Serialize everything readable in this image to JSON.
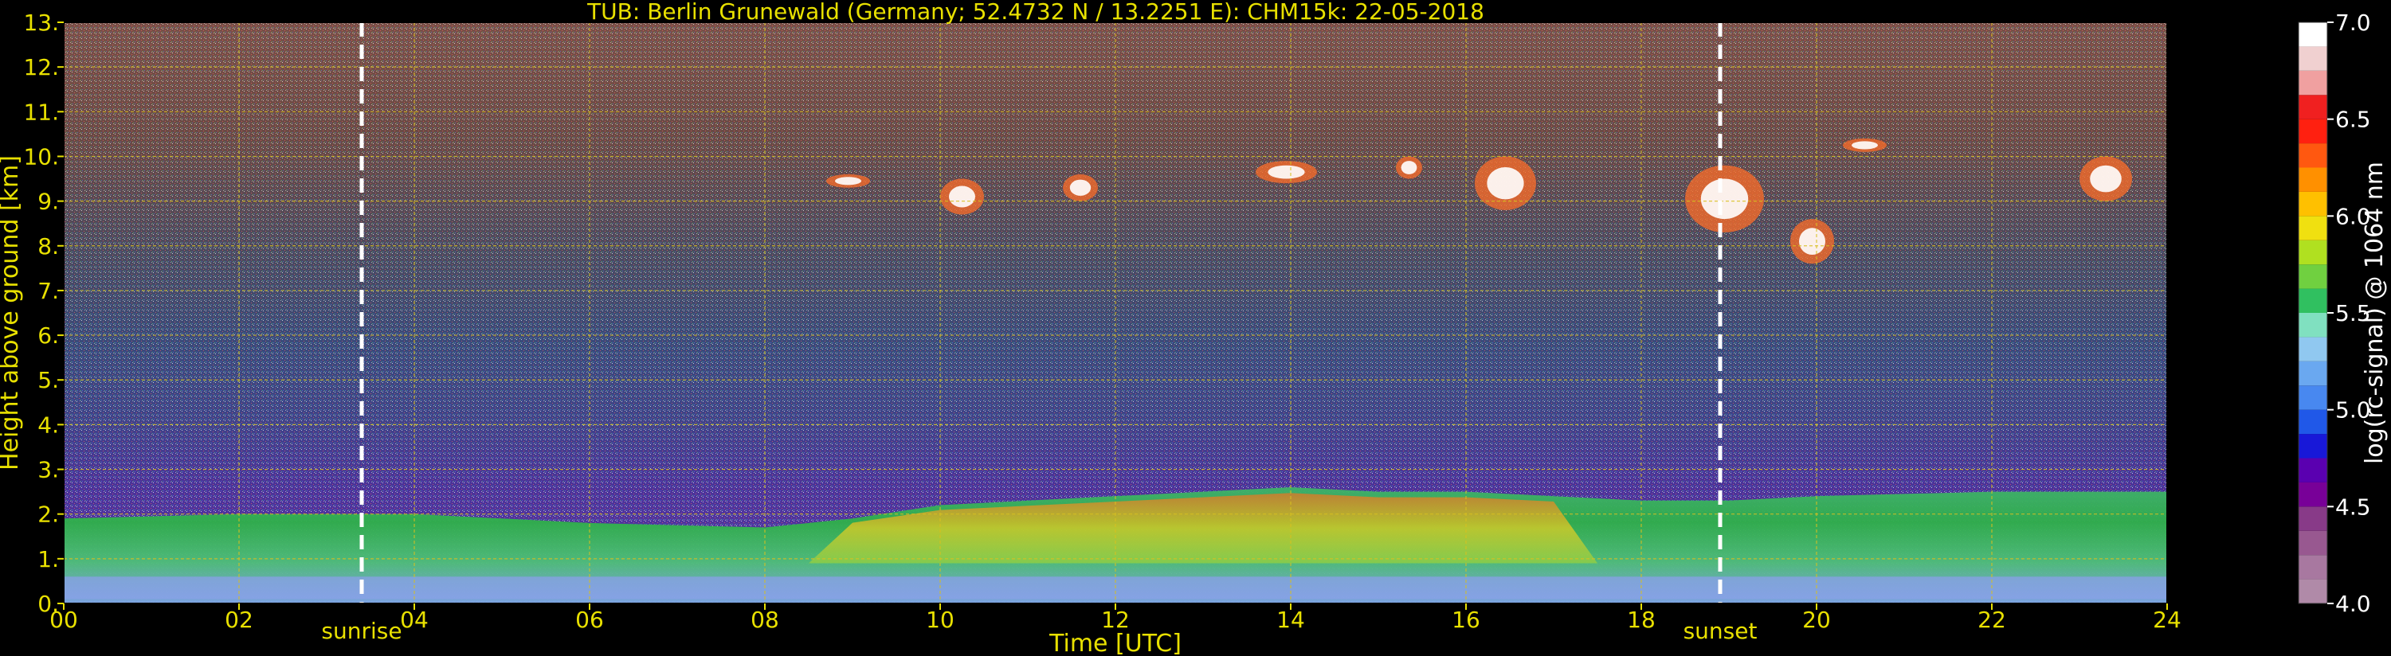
{
  "chart_data": {
    "type": "heatmap",
    "title": "TUB: Berlin Grunewald (Germany; 52.4732 N / 13.2251 E):    CHM15k: 22-05-2018",
    "xlabel": "Time [UTC]",
    "ylabel": "Height above ground [km]",
    "xlim": [
      0,
      24
    ],
    "ylim": [
      0,
      13
    ],
    "x_ticks": [
      0,
      2,
      4,
      6,
      8,
      10,
      12,
      14,
      16,
      18,
      20,
      22,
      24
    ],
    "x_tick_labels": [
      "00",
      "02",
      "04",
      "06",
      "08",
      "10",
      "12",
      "14",
      "16",
      "18",
      "20",
      "22",
      "24"
    ],
    "y_ticks": [
      0,
      1,
      2,
      3,
      4,
      5,
      6,
      7,
      8,
      9,
      10,
      11,
      12,
      13
    ],
    "y_tick_labels": [
      "0.",
      "1.",
      "2.",
      "3.",
      "4.",
      "5.",
      "6.",
      "7.",
      "8.",
      "9.",
      "10.",
      "11.",
      "12.",
      "13."
    ],
    "grid": true,
    "annotations": [
      {
        "label": "sunrise",
        "x": 3.4
      },
      {
        "label": "sunset",
        "x": 18.9
      }
    ],
    "colorbar": {
      "label": "log(rc-signal) @ 1064 nm",
      "range": [
        4.0,
        7.0
      ],
      "ticks": [
        4.0,
        4.5,
        5.0,
        5.5,
        6.0,
        6.5,
        7.0
      ],
      "tick_labels": [
        "4.0",
        "4.5",
        "5.0",
        "5.5",
        "6.0",
        "6.5",
        "7.0"
      ]
    },
    "boundary_layer_top_km": [
      {
        "x": 0,
        "y": 1.9
      },
      {
        "x": 2,
        "y": 2.0
      },
      {
        "x": 4,
        "y": 2.0
      },
      {
        "x": 6,
        "y": 1.8
      },
      {
        "x": 8,
        "y": 1.7
      },
      {
        "x": 9,
        "y": 1.9
      },
      {
        "x": 10,
        "y": 2.2
      },
      {
        "x": 11,
        "y": 2.3
      },
      {
        "x": 12,
        "y": 2.4
      },
      {
        "x": 13,
        "y": 2.5
      },
      {
        "x": 14,
        "y": 2.6
      },
      {
        "x": 15,
        "y": 2.5
      },
      {
        "x": 16,
        "y": 2.5
      },
      {
        "x": 17,
        "y": 2.4
      },
      {
        "x": 18,
        "y": 2.3
      },
      {
        "x": 19,
        "y": 2.3
      },
      {
        "x": 20,
        "y": 2.4
      },
      {
        "x": 22,
        "y": 2.5
      },
      {
        "x": 24,
        "y": 2.5
      }
    ],
    "cloud_features": [
      {
        "x": [
          8.7,
          9.2
        ],
        "y": [
          9.3,
          9.6
        ]
      },
      {
        "x": [
          10.0,
          10.5
        ],
        "y": [
          8.7,
          9.5
        ]
      },
      {
        "x": [
          11.4,
          11.8
        ],
        "y": [
          9.0,
          9.6
        ]
      },
      {
        "x": [
          13.6,
          14.3
        ],
        "y": [
          9.4,
          9.9
        ]
      },
      {
        "x": [
          15.2,
          15.5
        ],
        "y": [
          9.5,
          10.0
        ]
      },
      {
        "x": [
          16.1,
          16.8
        ],
        "y": [
          8.8,
          10.0
        ]
      },
      {
        "x": [
          18.5,
          19.4
        ],
        "y": [
          8.3,
          9.8
        ]
      },
      {
        "x": [
          19.7,
          20.2
        ],
        "y": [
          7.6,
          8.6
        ]
      },
      {
        "x": [
          20.3,
          20.8
        ],
        "y": [
          10.1,
          10.4
        ]
      },
      {
        "x": [
          23.0,
          23.6
        ],
        "y": [
          9.0,
          10.0
        ]
      }
    ]
  }
}
